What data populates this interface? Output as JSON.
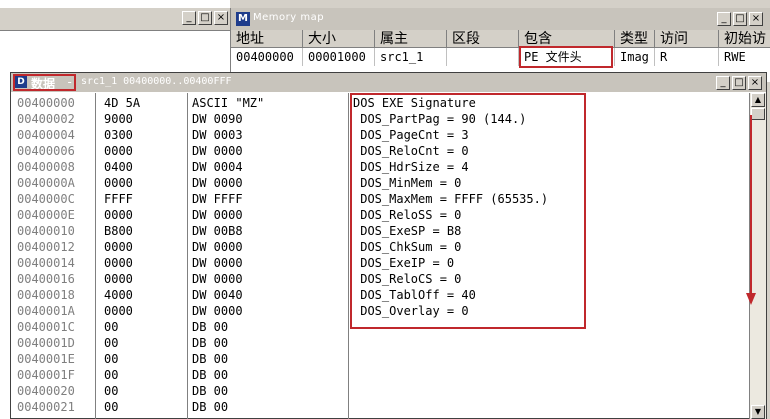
{
  "memory_map": {
    "title": "Memory map",
    "icon_letter": "M",
    "columns": [
      "地址",
      "大小",
      "属主",
      "区段",
      "包含",
      "类型",
      "访问",
      "初始访"
    ],
    "row": [
      "00400000",
      "00001000",
      "src1_1",
      "",
      "PE 文件头",
      "Imag",
      "R",
      "RWE"
    ]
  },
  "dump_window": {
    "icon_letter": "D",
    "label": "数据",
    "dash": "-",
    "title": "src1_1 00400000..00400FFF"
  },
  "controls": {
    "minimize": "_",
    "maximize": "□",
    "close": "×",
    "up": "▲",
    "down": "▼"
  },
  "dump": {
    "rows": [
      {
        "addr": "00400000",
        "hex": "4D 5A",
        "asm": "ASCII \"MZ\""
      },
      {
        "addr": "00400002",
        "hex": "9000",
        "asm": "DW 0090"
      },
      {
        "addr": "00400004",
        "hex": "0300",
        "asm": "DW 0003"
      },
      {
        "addr": "00400006",
        "hex": "0000",
        "asm": "DW 0000"
      },
      {
        "addr": "00400008",
        "hex": "0400",
        "asm": "DW 0004"
      },
      {
        "addr": "0040000A",
        "hex": "0000",
        "asm": "DW 0000"
      },
      {
        "addr": "0040000C",
        "hex": "FFFF",
        "asm": "DW FFFF"
      },
      {
        "addr": "0040000E",
        "hex": "0000",
        "asm": "DW 0000"
      },
      {
        "addr": "00400010",
        "hex": "B800",
        "asm": "DW 00B8"
      },
      {
        "addr": "00400012",
        "hex": "0000",
        "asm": "DW 0000"
      },
      {
        "addr": "00400014",
        "hex": "0000",
        "asm": "DW 0000"
      },
      {
        "addr": "00400016",
        "hex": "0000",
        "asm": "DW 0000"
      },
      {
        "addr": "00400018",
        "hex": "4000",
        "asm": "DW 0040"
      },
      {
        "addr": "0040001A",
        "hex": "0000",
        "asm": "DW 0000"
      },
      {
        "addr": "0040001C",
        "hex": "00",
        "asm": "DB 00"
      },
      {
        "addr": "0040001D",
        "hex": "00",
        "asm": "DB 00"
      },
      {
        "addr": "0040001E",
        "hex": "00",
        "asm": "DB 00"
      },
      {
        "addr": "0040001F",
        "hex": "00",
        "asm": "DB 00"
      },
      {
        "addr": "00400020",
        "hex": "00",
        "asm": "DB 00"
      },
      {
        "addr": "00400021",
        "hex": "00",
        "asm": "DB 00"
      }
    ],
    "comments": [
      "DOS EXE Signature",
      " DOS_PartPag = 90 (144.)",
      " DOS_PageCnt = 3",
      " DOS_ReloCnt = 0",
      " DOS_HdrSize = 4",
      " DOS_MinMem = 0",
      " DOS_MaxMem = FFFF (65535.)",
      " DOS_ReloSS = 0",
      " DOS_ExeSP = B8",
      " DOS_ChkSum = 0",
      " DOS_ExeIP = 0",
      " DOS_ReloCS = 0",
      " DOS_TablOff = 40",
      " DOS_Overlay = 0"
    ]
  },
  "colors": {
    "highlight": "#c0282c",
    "address": "#7f7f7f"
  }
}
